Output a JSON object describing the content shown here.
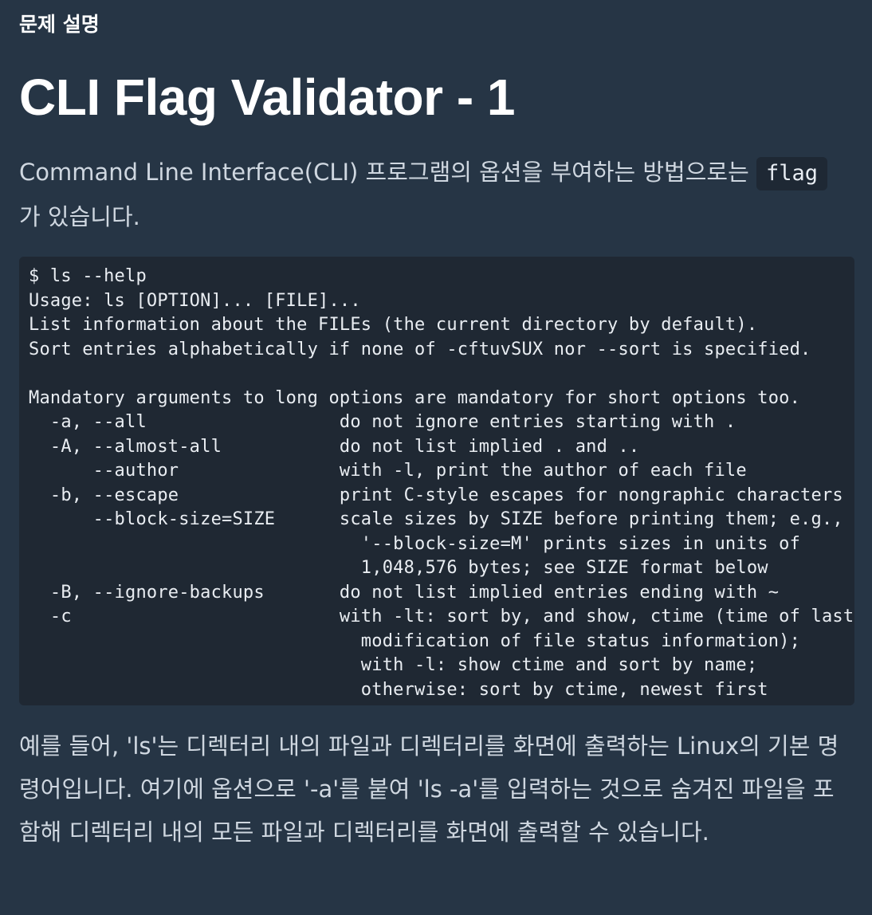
{
  "header": {
    "section_label": "문제 설명",
    "title": "CLI Flag Validator - 1"
  },
  "intro": {
    "text_before": "Command Line Interface(CLI) 프로그램의 옵션을 부여하는 방법으로는 ",
    "inline_code": "flag",
    "text_after": " 가 있습니다."
  },
  "code_block": {
    "lines": [
      "$ ls --help",
      "Usage: ls [OPTION]... [FILE]...",
      "List information about the FILEs (the current directory by default).",
      "Sort entries alphabetically if none of -cftuvSUX nor --sort is specified.",
      "",
      "Mandatory arguments to long options are mandatory for short options too.",
      "  -a, --all                  do not ignore entries starting with .",
      "  -A, --almost-all           do not list implied . and ..",
      "      --author               with -l, print the author of each file",
      "  -b, --escape               print C-style escapes for nongraphic characters",
      "      --block-size=SIZE      scale sizes by SIZE before printing them; e.g.,",
      "                               '--block-size=M' prints sizes in units of",
      "                               1,048,576 bytes; see SIZE format below",
      "  -B, --ignore-backups       do not list implied entries ending with ~",
      "  -c                         with -lt: sort by, and show, ctime (time of last",
      "                               modification of file status information);",
      "                               with -l: show ctime and sort by name;",
      "                               otherwise: sort by ctime, newest first"
    ]
  },
  "description": {
    "text": "예를 들어, 'ls'는 디렉터리 내의 파일과 디렉터리를 화면에 출력하는 Linux의 기본 명령어입니다. 여기에 옵션으로 '-a'를 붙여 'ls -a'를 입력하는 것으로 숨겨진 파일을 포함해 디렉터리 내의 모든 파일과 디렉터리를 화면에 출력할 수 있습니다."
  }
}
